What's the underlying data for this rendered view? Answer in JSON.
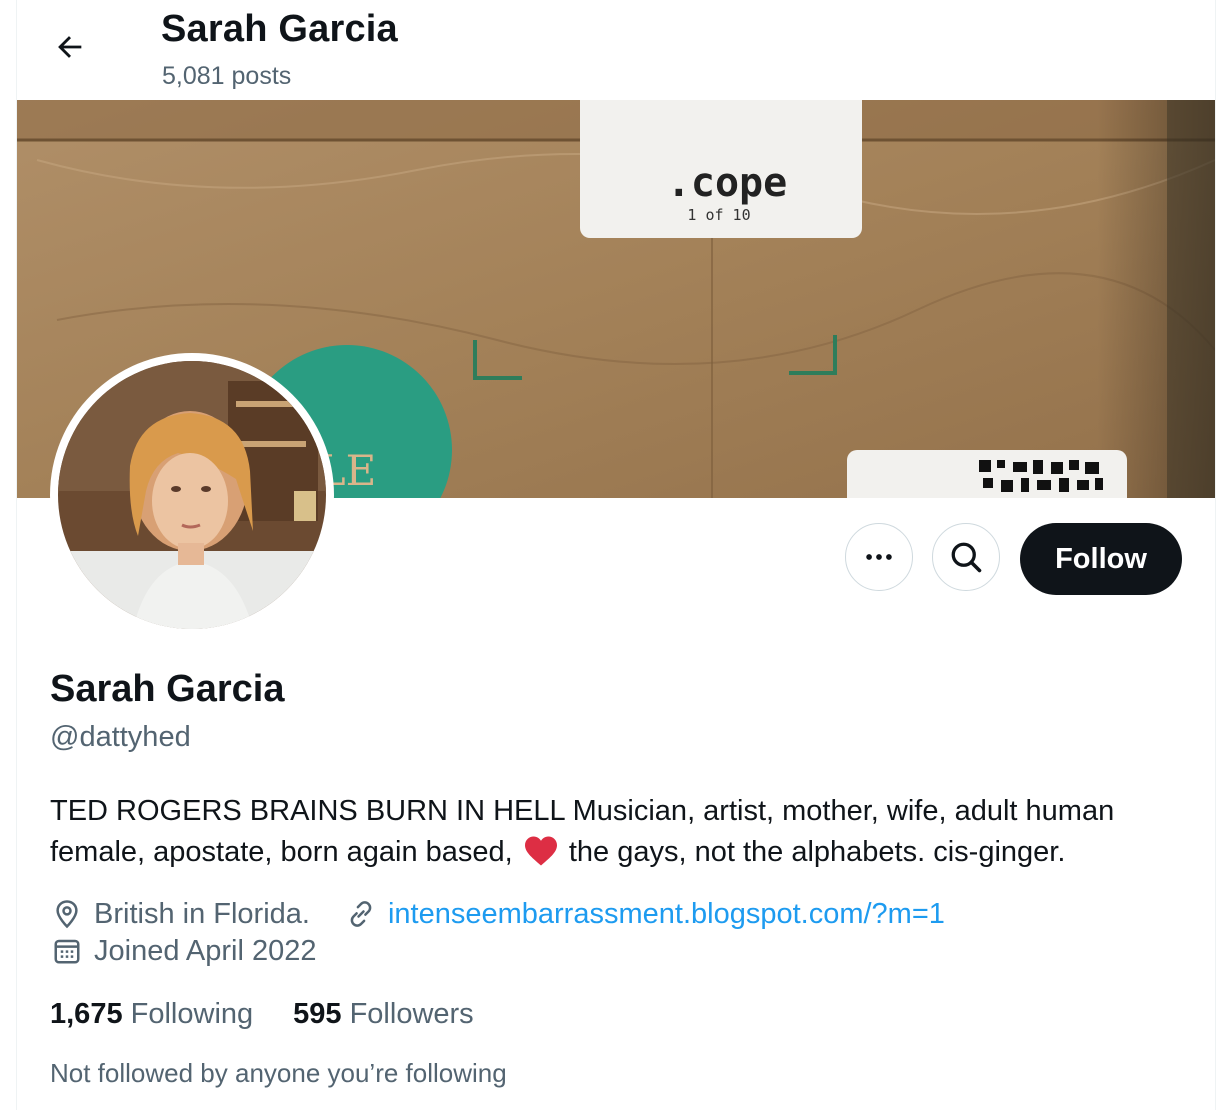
{
  "header": {
    "name": "Sarah Garcia",
    "posts": "5,081 posts"
  },
  "banner": {
    "label_text": ".cope",
    "label_sub": "1 of 10",
    "circle_text": "LE"
  },
  "actions": {
    "more_icon": "more-horizontal-icon",
    "search_icon": "search-icon",
    "follow_label": "Follow"
  },
  "profile": {
    "name": "Sarah Garcia",
    "handle": "@dattyhed",
    "bio_part1": "TED ROGERS BRAINS BURN IN HELL Musician, artist, mother, wife, adult human female, apostate, born again based,",
    "bio_part2": "the gays, not the alphabets. cis-ginger.",
    "location": "British in Florida.",
    "website": "intenseembarrassment.blogspot.com/?m=1",
    "joined": "Joined April 2022",
    "following_count": "1,675",
    "following_label": "Following",
    "followers_count": "595",
    "followers_label": "Followers",
    "not_followed": "Not followed by anyone you’re following"
  },
  "colors": {
    "accent": "#1d9bf0",
    "text": "#0f1419",
    "muted": "#536471",
    "heart": "#e0245e"
  }
}
